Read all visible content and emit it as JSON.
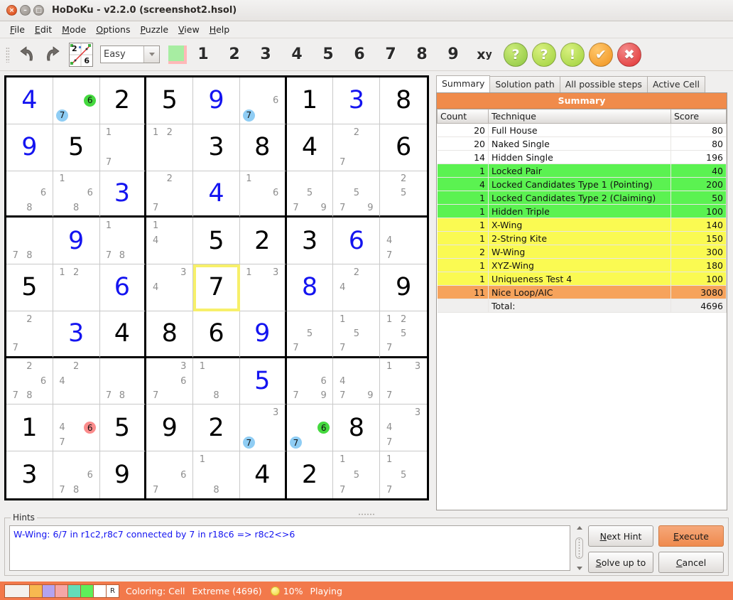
{
  "window": {
    "title": "HoDoKu - v2.2.0  (screenshot2.hsol)",
    "close_glyph": "×",
    "min_glyph": "–",
    "max_glyph": "□"
  },
  "menubar": {
    "items": [
      {
        "first": "F",
        "rest": "ile"
      },
      {
        "first": "E",
        "rest": "dit"
      },
      {
        "first": "M",
        "rest": "ode"
      },
      {
        "first": "O",
        "rest": "ptions"
      },
      {
        "first": "P",
        "rest": "uzzle"
      },
      {
        "first": "V",
        "rest": "iew"
      },
      {
        "first": "H",
        "rest": "elp"
      }
    ]
  },
  "toolbar": {
    "undo_label": "Undo",
    "redo_label": "Redo",
    "grid_btn_label": "2 6",
    "grid_btn_tl": "2",
    "grid_btn_br": "6",
    "level_value": "Easy",
    "color_label": "Color",
    "numbers": [
      "1",
      "2",
      "3",
      "4",
      "5",
      "6",
      "7",
      "8",
      "9"
    ],
    "xy_label": "x",
    "xy_sub": "y",
    "help1": "?",
    "help2": "?",
    "hint": "!",
    "check": "✔",
    "cancel": "✖"
  },
  "tabs": [
    {
      "label": "Summary",
      "active": true
    },
    {
      "label": "Solution path",
      "active": false
    },
    {
      "label": "All possible steps",
      "active": false
    },
    {
      "label": "Active Cell",
      "active": false
    }
  ],
  "summary": {
    "title": "Summary",
    "columns": [
      "Count",
      "Technique",
      "Score"
    ],
    "rows": [
      {
        "count": "20",
        "technique": "Full House",
        "score": "80",
        "style": "white"
      },
      {
        "count": "20",
        "technique": "Naked Single",
        "score": "80",
        "style": "white"
      },
      {
        "count": "14",
        "technique": "Hidden Single",
        "score": "196",
        "style": "white"
      },
      {
        "count": "1",
        "technique": "Locked Pair",
        "score": "40",
        "style": "green"
      },
      {
        "count": "4",
        "technique": "Locked Candidates Type 1 (Pointing)",
        "score": "200",
        "style": "green"
      },
      {
        "count": "1",
        "technique": "Locked Candidates Type 2 (Claiming)",
        "score": "50",
        "style": "green"
      },
      {
        "count": "1",
        "technique": "Hidden Triple",
        "score": "100",
        "style": "green"
      },
      {
        "count": "1",
        "technique": "X-Wing",
        "score": "140",
        "style": "yellow"
      },
      {
        "count": "1",
        "technique": "2-String Kite",
        "score": "150",
        "style": "yellow"
      },
      {
        "count": "2",
        "technique": "W-Wing",
        "score": "300",
        "style": "yellow"
      },
      {
        "count": "1",
        "technique": "XYZ-Wing",
        "score": "180",
        "style": "yellow"
      },
      {
        "count": "1",
        "technique": "Uniqueness Test 4",
        "score": "100",
        "style": "yellow"
      },
      {
        "count": "11",
        "technique": "Nice Loop/AIC",
        "score": "3080",
        "style": "orange"
      },
      {
        "count": "",
        "technique": "Total:",
        "score": "4696",
        "style": "total"
      }
    ]
  },
  "hints": {
    "legend": "Hints",
    "text": "W-Wing: 6/7 in r1c2,r8c7 connected by 7 in r18c6 => r8c2<>6",
    "buttons": {
      "next_hint_u": "N",
      "next_hint_rest": "ext Hint",
      "execute_u": "E",
      "execute_rest": "xecute",
      "solve_up_to_u": "S",
      "solve_up_to_rest": "olve up to",
      "cancel_u": "C",
      "cancel_rest": "ancel"
    }
  },
  "statusbar": {
    "swatches": [
      "#f4f1ee",
      "#f7b850",
      "#b3a3f0",
      "#f5a6a6",
      "#64ddb8",
      "#5eef5a",
      "#ffffff"
    ],
    "r_label": "R",
    "coloring": "Coloring: Cell",
    "difficulty": "Extreme (4696)",
    "progress": "10%",
    "state": "Playing"
  },
  "colors": {
    "accent_orange": "#f2794b",
    "given": "#000000",
    "solved": "#1414f0",
    "candidate": "#8d8d8d",
    "green_row": "#5bf251",
    "yellow_row": "#fafa52",
    "orange_row": "#f6a35c",
    "selection": "#f7f06a"
  },
  "grid": {
    "selected_cell": "r5c5",
    "cells": [
      [
        {
          "value": "4",
          "state": "set"
        },
        {
          "cands": [
            {
              "d": "6",
              "hl": "green"
            },
            {
              "d": "7",
              "hl": "blue"
            }
          ]
        },
        {
          "value": "2",
          "state": "given"
        },
        {
          "value": "5",
          "state": "given"
        },
        {
          "value": "9",
          "state": "set"
        },
        {
          "cands": [
            {
              "d": "6"
            },
            {
              "d": "7",
              "hl": "blue"
            }
          ]
        },
        {
          "value": "1",
          "state": "given"
        },
        {
          "value": "3",
          "state": "set"
        },
        {
          "value": "8",
          "state": "given"
        }
      ],
      [
        {
          "value": "9",
          "state": "set"
        },
        {
          "value": "5",
          "state": "given"
        },
        {
          "cands": [
            {
              "d": "1"
            },
            {
              "d": "7"
            }
          ]
        },
        {
          "cands": [
            {
              "d": "1"
            },
            {
              "d": "2"
            }
          ]
        },
        {
          "value": "3",
          "state": "given"
        },
        {
          "value": "8",
          "state": "given"
        },
        {
          "value": "4",
          "state": "given"
        },
        {
          "cands": [
            {
              "d": "2"
            },
            {
              "d": "7"
            }
          ]
        },
        {
          "value": "6",
          "state": "given"
        }
      ],
      [
        {
          "cands": [
            {
              "d": "6"
            },
            {
              "d": "8"
            }
          ]
        },
        {
          "cands": [
            {
              "d": "1"
            },
            {
              "d": "6"
            },
            {
              "d": "8"
            }
          ]
        },
        {
          "value": "3",
          "state": "set"
        },
        {
          "cands": [
            {
              "d": "2"
            },
            {
              "d": "7"
            }
          ]
        },
        {
          "value": "4",
          "state": "set"
        },
        {
          "cands": [
            {
              "d": "1"
            },
            {
              "d": "6"
            }
          ]
        },
        {
          "cands": [
            {
              "d": "5"
            },
            {
              "d": "7"
            },
            {
              "d": "9"
            }
          ]
        },
        {
          "cands": [
            {
              "d": "5"
            },
            {
              "d": "7"
            },
            {
              "d": "9"
            }
          ]
        },
        {
          "cands": [
            {
              "d": "2"
            },
            {
              "d": "5"
            }
          ]
        }
      ],
      [
        {
          "cands": [
            {
              "d": "7"
            },
            {
              "d": "8"
            }
          ]
        },
        {
          "value": "9",
          "state": "set"
        },
        {
          "cands": [
            {
              "d": "1"
            },
            {
              "d": "7"
            },
            {
              "d": "8"
            }
          ]
        },
        {
          "cands": [
            {
              "d": "1"
            },
            {
              "d": "4"
            }
          ]
        },
        {
          "value": "5",
          "state": "given"
        },
        {
          "value": "2",
          "state": "given"
        },
        {
          "value": "3",
          "state": "given"
        },
        {
          "value": "6",
          "state": "set"
        },
        {
          "cands": [
            {
              "d": "4"
            },
            {
              "d": "7"
            }
          ]
        }
      ],
      [
        {
          "value": "5",
          "state": "given"
        },
        {
          "cands": [
            {
              "d": "1"
            },
            {
              "d": "2"
            }
          ]
        },
        {
          "value": "6",
          "state": "set"
        },
        {
          "cands": [
            {
              "d": "3"
            },
            {
              "d": "4"
            }
          ]
        },
        {
          "value": "7",
          "state": "given",
          "selected": true
        },
        {
          "cands": [
            {
              "d": "1"
            },
            {
              "d": "3"
            }
          ]
        },
        {
          "value": "8",
          "state": "set"
        },
        {
          "cands": [
            {
              "d": "2"
            },
            {
              "d": "4"
            }
          ]
        },
        {
          "value": "9",
          "state": "given"
        }
      ],
      [
        {
          "cands": [
            {
              "d": "2"
            },
            {
              "d": "7"
            }
          ]
        },
        {
          "value": "3",
          "state": "set"
        },
        {
          "value": "4",
          "state": "given"
        },
        {
          "value": "8",
          "state": "given"
        },
        {
          "value": "6",
          "state": "given"
        },
        {
          "value": "9",
          "state": "set"
        },
        {
          "cands": [
            {
              "d": "5"
            },
            {
              "d": "7"
            }
          ]
        },
        {
          "cands": [
            {
              "d": "1"
            },
            {
              "d": "5"
            },
            {
              "d": "7"
            }
          ]
        },
        {
          "cands": [
            {
              "d": "1"
            },
            {
              "d": "2"
            },
            {
              "d": "5"
            },
            {
              "d": "7"
            }
          ]
        }
      ],
      [
        {
          "cands": [
            {
              "d": "2"
            },
            {
              "d": "6"
            },
            {
              "d": "7"
            },
            {
              "d": "8"
            }
          ]
        },
        {
          "cands": [
            {
              "d": "2"
            },
            {
              "d": "4"
            }
          ]
        },
        {
          "cands": [
            {
              "d": "7"
            },
            {
              "d": "8"
            }
          ]
        },
        {
          "cands": [
            {
              "d": "3"
            },
            {
              "d": "6"
            },
            {
              "d": "7"
            }
          ]
        },
        {
          "cands": [
            {
              "d": "1"
            },
            {
              "d": "8"
            }
          ]
        },
        {
          "value": "5",
          "state": "set"
        },
        {
          "cands": [
            {
              "d": "6"
            },
            {
              "d": "7"
            },
            {
              "d": "9"
            }
          ]
        },
        {
          "cands": [
            {
              "d": "4"
            },
            {
              "d": "7"
            },
            {
              "d": "9"
            }
          ]
        },
        {
          "cands": [
            {
              "d": "1"
            },
            {
              "d": "3"
            },
            {
              "d": "7"
            }
          ]
        }
      ],
      [
        {
          "value": "1",
          "state": "given"
        },
        {
          "cands": [
            {
              "d": "4"
            },
            {
              "d": "6",
              "hl": "red"
            },
            {
              "d": "7"
            }
          ]
        },
        {
          "value": "5",
          "state": "given"
        },
        {
          "value": "9",
          "state": "given"
        },
        {
          "value": "2",
          "state": "given"
        },
        {
          "cands": [
            {
              "d": "3"
            },
            {
              "d": "7",
              "hl": "blue"
            }
          ]
        },
        {
          "cands": [
            {
              "d": "6",
              "hl": "green"
            },
            {
              "d": "7",
              "hl": "blue"
            }
          ]
        },
        {
          "value": "8",
          "state": "given"
        },
        {
          "cands": [
            {
              "d": "3"
            },
            {
              "d": "4"
            },
            {
              "d": "7"
            }
          ]
        }
      ],
      [
        {
          "value": "3",
          "state": "given"
        },
        {
          "cands": [
            {
              "d": "6"
            },
            {
              "d": "7"
            },
            {
              "d": "8"
            }
          ]
        },
        {
          "value": "9",
          "state": "given"
        },
        {
          "cands": [
            {
              "d": "6"
            },
            {
              "d": "7"
            }
          ]
        },
        {
          "cands": [
            {
              "d": "1"
            },
            {
              "d": "8"
            }
          ]
        },
        {
          "value": "4",
          "state": "given"
        },
        {
          "value": "2",
          "state": "given"
        },
        {
          "cands": [
            {
              "d": "1"
            },
            {
              "d": "5"
            },
            {
              "d": "7"
            }
          ]
        },
        {
          "cands": [
            {
              "d": "1"
            },
            {
              "d": "5"
            },
            {
              "d": "7"
            }
          ]
        }
      ]
    ]
  }
}
